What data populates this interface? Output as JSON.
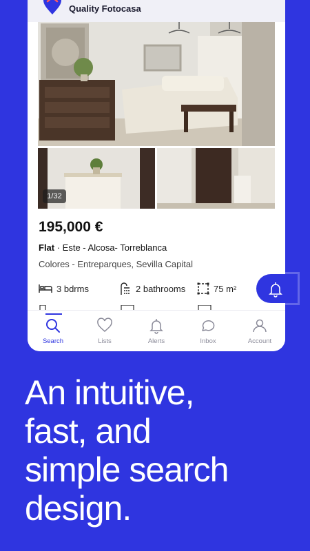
{
  "badge": {
    "text": "Quality Fotocasa"
  },
  "listing": {
    "photo_counter": "1/32",
    "price": "195,000 €",
    "type": "Flat",
    "title_rest": " · Este - Alcosa- Torreblanca",
    "location": "Colores - Entreparques, Sevilla Capital",
    "bedrooms": "3 bdrms",
    "bathrooms": "2 bathrooms",
    "area": "75 m²"
  },
  "nav": {
    "items": [
      {
        "label": "Search",
        "icon": "search-icon",
        "active": true
      },
      {
        "label": "Lists",
        "icon": "heart-icon"
      },
      {
        "label": "Alerts",
        "icon": "bell-icon"
      },
      {
        "label": "Inbox",
        "icon": "chat-icon"
      },
      {
        "label": "Account",
        "icon": "user-icon"
      }
    ]
  },
  "promo": {
    "line1": "An intuitive,",
    "line2": "fast, and",
    "line3": "simple search",
    "line4": "design."
  },
  "colors": {
    "brand": "#2f35e0",
    "text": "#111111"
  }
}
